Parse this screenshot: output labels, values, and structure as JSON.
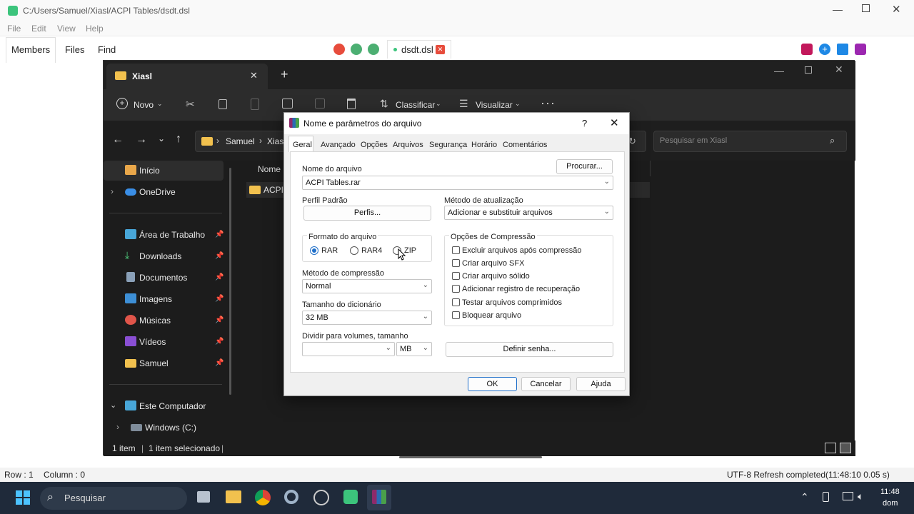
{
  "editor": {
    "title": "C:/Users/Samuel/Xiasl/ACPI Tables/dsdt.dsl",
    "menu": [
      "File",
      "Edit",
      "View",
      "Help"
    ],
    "side_tabs": [
      "Members",
      "Files",
      "Find"
    ],
    "doc_tab": "dsdt.dsl",
    "status": {
      "row": "Row : 1",
      "column": "Column : 0",
      "right": "UTF-8  Refresh completed(11:48:10   0.05 s)"
    }
  },
  "explorer": {
    "tab_title": "Xiasl",
    "toolbar": {
      "new": "Novo",
      "sort": "Classificar",
      "view": "Visualizar"
    },
    "breadcrumb": [
      "Samuel",
      "Xiasl"
    ],
    "search_placeholder": "Pesquisar em Xiasl",
    "column_name": "Nome",
    "file_name": "ACPI T",
    "nav": [
      {
        "label": "Início",
        "icon": "home-icon"
      },
      {
        "label": "OneDrive",
        "icon": "cloud-icon"
      },
      {
        "label": "Área de Trabalho",
        "icon": "desktop-icon"
      },
      {
        "label": "Downloads",
        "icon": "download-icon"
      },
      {
        "label": "Documentos",
        "icon": "document-icon"
      },
      {
        "label": "Imagens",
        "icon": "image-icon"
      },
      {
        "label": "Músicas",
        "icon": "music-icon"
      },
      {
        "label": "Vídeos",
        "icon": "video-icon"
      },
      {
        "label": "Samuel",
        "icon": "folder-icon"
      },
      {
        "label": "Este Computador",
        "icon": "computer-icon"
      },
      {
        "label": "Windows (C:)",
        "icon": "drive-icon"
      }
    ],
    "status": {
      "count": "1 item",
      "selected": "1 item selecionado"
    }
  },
  "dialog": {
    "title": "Nome e parâmetros do arquivo",
    "help": "?",
    "tabs": [
      "Geral",
      "Avançado",
      "Opções",
      "Arquivos",
      "Segurança",
      "Horário",
      "Comentários"
    ],
    "browse": "Procurar...",
    "archive_name_label": "Nome do arquivo",
    "archive_name": "ACPI Tables.rar",
    "profile_label": "Perfil Padrão",
    "profiles_button": "Perfis...",
    "update_method_label": "Método de atualização",
    "update_method": "Adicionar e substituir arquivos",
    "format_label": "Formato do arquivo",
    "formats": [
      "RAR",
      "RAR4",
      "ZIP"
    ],
    "selected_format": "RAR",
    "compression_method_label": "Método de compressão",
    "compression_method": "Normal",
    "dictionary_label": "Tamanho do dicionário",
    "dictionary": "32 MB",
    "split_label": "Dividir para volumes, tamanho",
    "split_value": "",
    "split_unit": "MB",
    "options_label": "Opções de Compressão",
    "options": [
      "Excluir arquivos após compressão",
      "Criar arquivo SFX",
      "Criar arquivo sólido",
      "Adicionar registro de recuperação",
      "Testar arquivos comprimidos",
      "Bloquear arquivo"
    ],
    "password_button": "Definir senha...",
    "ok": "OK",
    "cancel": "Cancelar",
    "help_button": "Ajuda"
  },
  "taskbar": {
    "search": "Pesquisar",
    "time": "11:48",
    "day": "dom"
  },
  "colors": {
    "explorer_bg": "#1c1c1c",
    "accent": "#1f6fc9",
    "taskbar": "#1f2a3a"
  }
}
